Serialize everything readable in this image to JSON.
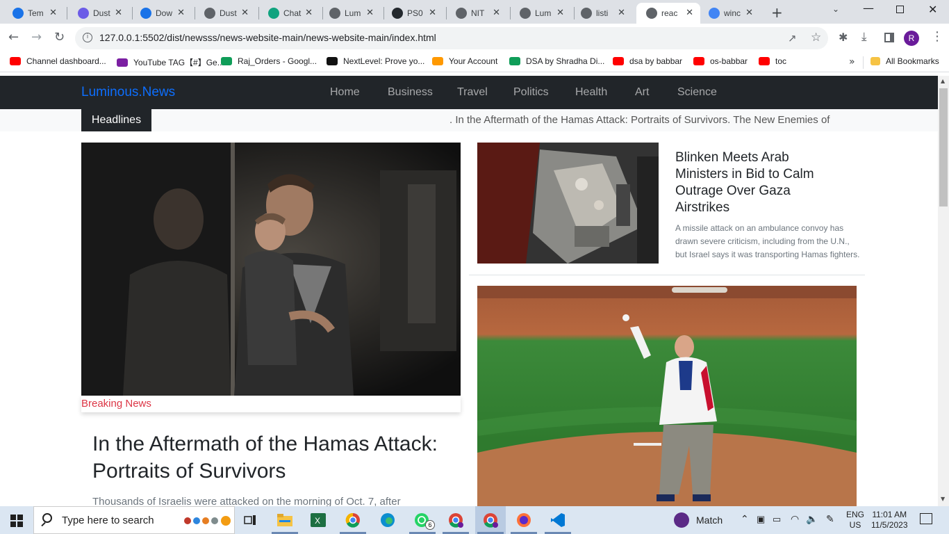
{
  "browser": {
    "tabs": [
      {
        "title": "Tem",
        "icon": "edge-icon",
        "color": "#1a73e8"
      },
      {
        "title": "Dust",
        "icon": "chat-icon",
        "color": "#6c5ce7"
      },
      {
        "title": "Dow",
        "icon": "download-icon",
        "color": "#1a73e8"
      },
      {
        "title": "Dust",
        "icon": "globe-icon",
        "color": "#5f6368"
      },
      {
        "title": "Chat",
        "icon": "chatgpt-icon",
        "color": "#10a37f"
      },
      {
        "title": "Lum",
        "icon": "globe-icon",
        "color": "#5f6368"
      },
      {
        "title": "PS0",
        "icon": "github-icon",
        "color": "#24292e"
      },
      {
        "title": "NIT",
        "icon": "globe-icon",
        "color": "#5f6368"
      },
      {
        "title": "Lum",
        "icon": "globe-icon",
        "color": "#5f6368"
      },
      {
        "title": "listi",
        "icon": "globe-icon",
        "color": "#5f6368"
      },
      {
        "title": "reac",
        "icon": "globe-icon",
        "color": "#5f6368",
        "active": true
      },
      {
        "title": "winc",
        "icon": "google-icon",
        "color": "#4285f4"
      }
    ],
    "url": "127.0.0.1:5502/dist/newsss/news-website-main/news-website-main/index.html",
    "profile_initial": "R",
    "bookmarks": [
      {
        "label": "Channel dashboard...",
        "color": "#ff0000"
      },
      {
        "label": "YouTube TAG【#】Ge...",
        "color": "#7b1fa2"
      },
      {
        "label": "Raj_Orders - Googl...",
        "color": "#0f9d58"
      },
      {
        "label": "NextLevel: Prove yo...",
        "color": "#111111"
      },
      {
        "label": "Your Account",
        "color": "#ff9900"
      },
      {
        "label": "DSA by Shradha Di...",
        "color": "#0f9d58"
      },
      {
        "label": "dsa by babbar",
        "color": "#ff0000"
      },
      {
        "label": "os-babbar",
        "color": "#ff0000"
      },
      {
        "label": "toc",
        "color": "#ff0000"
      }
    ],
    "overflow": "»",
    "all_bookmarks": "All Bookmarks"
  },
  "site": {
    "brand": "Luminous.News",
    "nav": [
      "Home",
      "Business",
      "Travel",
      "Politics",
      "Health",
      "Art",
      "Science"
    ],
    "headlines_label": "Headlines",
    "ticker": ".  In the Aftermath of the Hamas Attack: Portraits of Survivors.  The New Enemies of"
  },
  "main_story": {
    "category": "Breaking News",
    "headline": "In the Aftermath of the Hamas Attack: Portraits of Survivors",
    "summary": "Thousands of Israelis were attacked on the morning of Oct. 7, after"
  },
  "side_story": {
    "headline": "Blinken Meets Arab Ministers in Bid to Calm Outrage Over Gaza Airstrikes",
    "summary": "A missile attack on an ambulance convoy has drawn severe criticism, including from the U.N., but Israel says it was transporting Hamas fighters."
  },
  "taskbar": {
    "search_placeholder": "Type here to search",
    "weather": "Match",
    "lang1": "ENG",
    "lang2": "US",
    "time": "11:01 AM",
    "date": "11/5/2023",
    "whatsapp_badge": "6"
  }
}
